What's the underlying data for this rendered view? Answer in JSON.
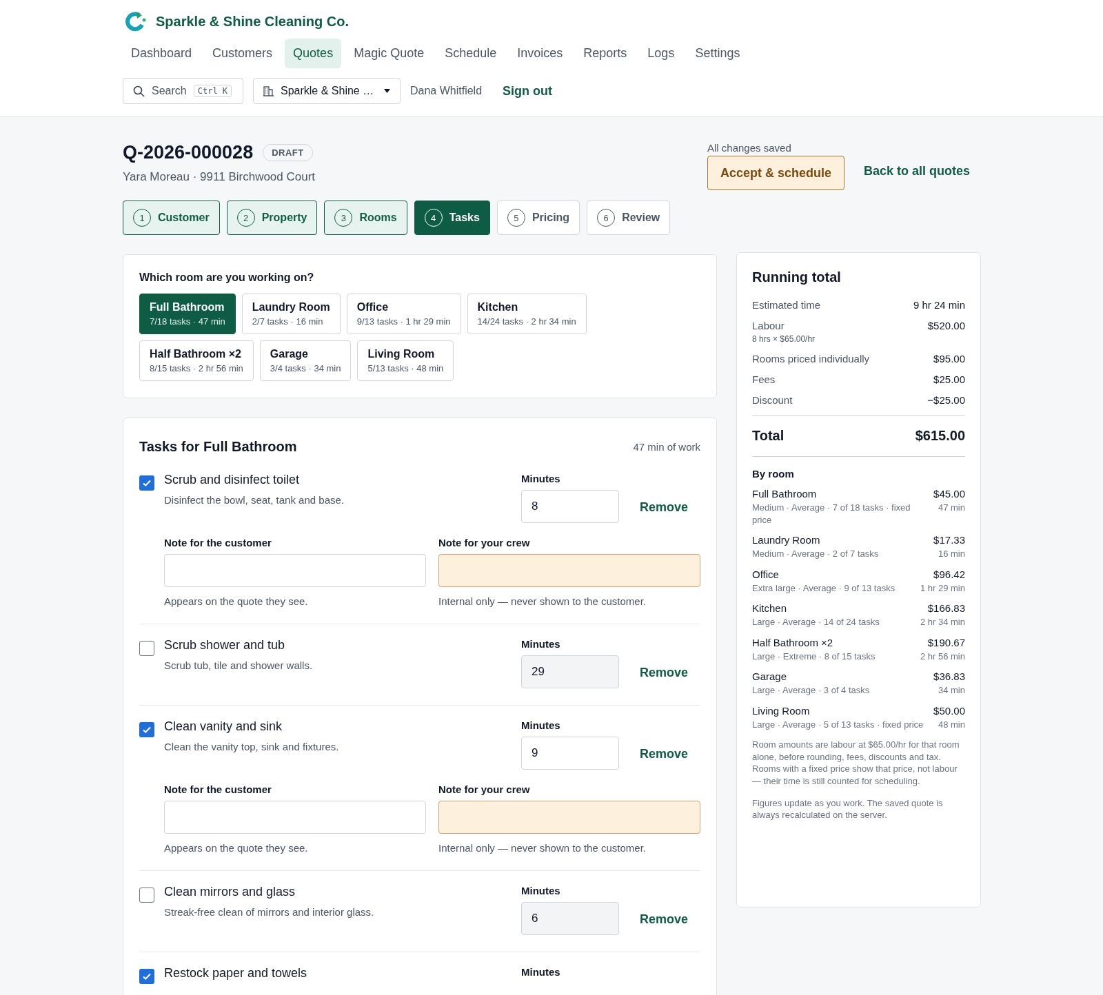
{
  "brand": {
    "name": "Sparkle & Shine Cleaning Co."
  },
  "nav": [
    {
      "label": "Dashboard",
      "selected": false
    },
    {
      "label": "Customers",
      "selected": false
    },
    {
      "label": "Quotes",
      "selected": true
    },
    {
      "label": "Magic Quote",
      "selected": false
    },
    {
      "label": "Schedule",
      "selected": false
    },
    {
      "label": "Invoices",
      "selected": false
    },
    {
      "label": "Reports",
      "selected": false
    },
    {
      "label": "Logs",
      "selected": false
    },
    {
      "label": "Settings",
      "selected": false
    }
  ],
  "toolbar": {
    "search_placeholder": "Search",
    "shortcut": "Ctrl K",
    "company": "Sparkle & Shine …",
    "user": "Dana Whitfield",
    "sign_out": "Sign out"
  },
  "quote": {
    "number": "Q-2026-000028",
    "status": "DRAFT",
    "subtitle": "Yara Moreau · 9911 Birchwood Court",
    "save_state": "All changes saved",
    "accept": "Accept & schedule",
    "back": "Back to all quotes"
  },
  "steps": [
    {
      "number": "1",
      "label": "Customer",
      "completed": true,
      "selected": false
    },
    {
      "number": "2",
      "label": "Property",
      "completed": true,
      "selected": false
    },
    {
      "number": "3",
      "label": "Rooms",
      "completed": true,
      "selected": false
    },
    {
      "number": "4",
      "label": "Tasks",
      "completed": false,
      "selected": true
    },
    {
      "number": "5",
      "label": "Pricing",
      "completed": false,
      "selected": false
    },
    {
      "number": "6",
      "label": "Review",
      "completed": false,
      "selected": false
    }
  ],
  "room_picker": {
    "question": "Which room are you working on?",
    "rooms": [
      {
        "name": "Full Bathroom",
        "meta": "7/18 tasks · 47 min",
        "selected": true
      },
      {
        "name": "Laundry Room",
        "meta": "2/7 tasks · 16 min",
        "selected": false
      },
      {
        "name": "Office",
        "meta": "9/13 tasks · 1 hr 29 min",
        "selected": false
      },
      {
        "name": "Kitchen",
        "meta": "14/24 tasks · 2 hr 34 min",
        "selected": false
      },
      {
        "name": "Half Bathroom ×2",
        "meta": "8/15 tasks · 2 hr 56 min",
        "selected": false
      },
      {
        "name": "Garage",
        "meta": "3/4 tasks · 34 min",
        "selected": false
      },
      {
        "name": "Living Room",
        "meta": "5/13 tasks · 48 min",
        "selected": false
      }
    ]
  },
  "tasks": {
    "title": "Tasks for Full Bathroom",
    "summary": "47 min of work",
    "items": [
      {
        "name": "Scrub and disinfect toilet",
        "description": "Disinfect the bowl, seat, tank and base.",
        "checked": true,
        "minutes_label": "Minutes",
        "minutes": "8",
        "remove": "Remove",
        "customer_note_label": "Note for the customer",
        "customer_note_hint": "Appears on the quote they see.",
        "crew_note_label": "Note for your crew",
        "crew_note_hint": "Internal only — never shown to the customer."
      },
      {
        "name": "Scrub shower and tub",
        "description": "Scrub tub, tile and shower walls.",
        "checked": false,
        "minutes_label": "Minutes",
        "minutes": "29",
        "remove": "Remove"
      },
      {
        "name": "Clean vanity and sink",
        "description": "Clean the vanity top, sink and fixtures.",
        "checked": true,
        "minutes_label": "Minutes",
        "minutes": "9",
        "remove": "Remove",
        "customer_note_label": "Note for the customer",
        "customer_note_hint": "Appears on the quote they see.",
        "crew_note_label": "Note for your crew",
        "crew_note_hint": "Internal only — never shown to the customer."
      },
      {
        "name": "Clean mirrors and glass",
        "description": "Streak-free clean of mirrors and interior glass.",
        "checked": false,
        "minutes_label": "Minutes",
        "minutes": "6",
        "remove": "Remove"
      },
      {
        "name": "Restock paper and towels",
        "checked": true,
        "minutes_label": "Minutes"
      }
    ]
  },
  "running_total": {
    "title": "Running total",
    "lines": [
      {
        "label": "Estimated time",
        "value": "9 hr 24 min"
      },
      {
        "label": "Labour",
        "sub": "8 hrs × $65.00/hr",
        "value": "$520.00"
      },
      {
        "label": "Rooms priced individually",
        "value": "$95.00"
      },
      {
        "label": "Fees",
        "value": "$25.00"
      },
      {
        "label": "Discount",
        "value": "−$25.00"
      }
    ],
    "total_label": "Total",
    "total": "$615.00",
    "by_room_title": "By room",
    "rooms": [
      {
        "name": "Full Bathroom",
        "detail": "Medium · Average · 7 of 18 tasks · fixed price",
        "amount": "$45.00",
        "time": "47 min"
      },
      {
        "name": "Laundry Room",
        "detail": "Medium · Average · 2 of 7 tasks",
        "amount": "$17.33",
        "time": "16 min"
      },
      {
        "name": "Office",
        "detail": "Extra large · Average · 9 of 13 tasks",
        "amount": "$96.42",
        "time": "1 hr 29 min"
      },
      {
        "name": "Kitchen",
        "detail": "Large · Average · 14 of 24 tasks",
        "amount": "$166.83",
        "time": "2 hr 34 min"
      },
      {
        "name": "Half Bathroom ×2",
        "detail": "Large · Extreme · 8 of 15 tasks",
        "amount": "$190.67",
        "time": "2 hr 56 min"
      },
      {
        "name": "Garage",
        "detail": "Large · Average · 3 of 4 tasks",
        "amount": "$36.83",
        "time": "34 min"
      },
      {
        "name": "Living Room",
        "detail": "Large · Average · 5 of 13 tasks · fixed price",
        "amount": "$50.00",
        "time": "48 min"
      }
    ],
    "notes": [
      "Room amounts are labour at $65.00/hr for that room alone, before rounding, fees, discounts and tax. Rooms with a fixed price show that price, not labour — their time is still counted for scheduling.",
      "Figures update as you work. The saved quote is always recalculated on the server."
    ]
  }
}
